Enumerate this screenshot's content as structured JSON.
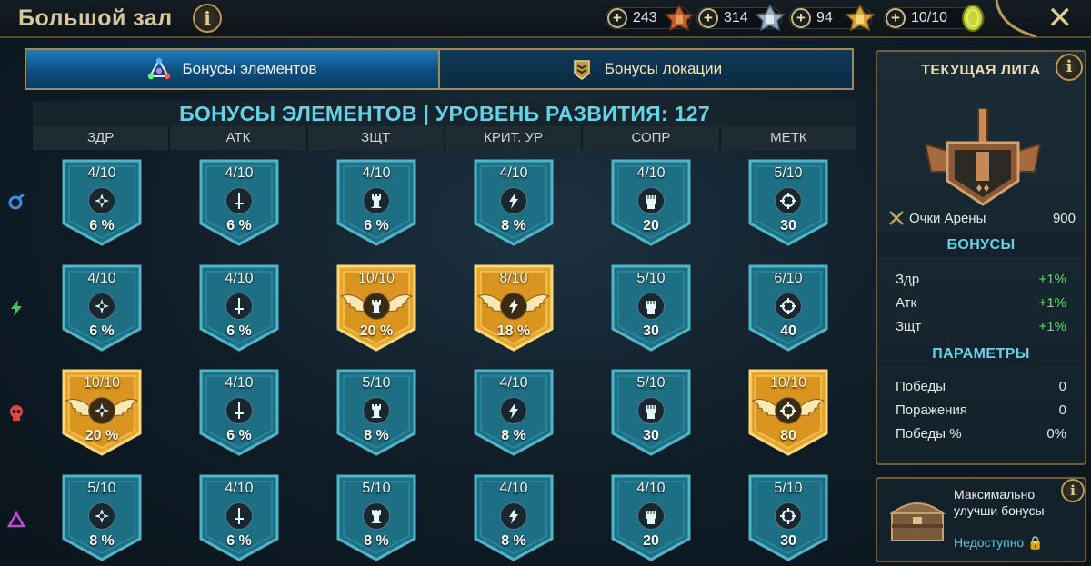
{
  "header": {
    "title": "Большой зал",
    "resources": [
      {
        "value": "243",
        "icon": "bronze-medal-icon",
        "color": "#c2622e"
      },
      {
        "value": "314",
        "icon": "silver-medal-icon",
        "color": "#9ab0c0"
      },
      {
        "value": "94",
        "icon": "gold-medal-icon",
        "color": "#d8a63a"
      },
      {
        "value": "10/10",
        "icon": "arena-token-icon",
        "color": "#c8d43a"
      }
    ]
  },
  "tabs": [
    {
      "label": "Бонусы элементов",
      "active": true,
      "icon": "elements-icon"
    },
    {
      "label": "Бонусы локации",
      "active": false,
      "icon": "location-rank-icon"
    }
  ],
  "grid": {
    "title": "БОНУСЫ ЭЛЕМЕНТОВ | УРОВЕНЬ РАЗВИТИЯ: 127",
    "columns": [
      "ЗДР",
      "АТК",
      "ЗЩТ",
      "КРИТ. УР",
      "СОПР",
      "МЕТК"
    ],
    "column_icons": [
      "health-icon",
      "sword-icon",
      "tower-icon",
      "lightning-icon",
      "fist-icon",
      "crosshair-icon"
    ],
    "rows": [
      {
        "affinity": "magic-affinity-icon",
        "color": "#3c8ce6",
        "cells": [
          {
            "level": "4/10",
            "value": "6 %",
            "max": false
          },
          {
            "level": "4/10",
            "value": "6 %",
            "max": false
          },
          {
            "level": "4/10",
            "value": "6 %",
            "max": false
          },
          {
            "level": "4/10",
            "value": "8 %",
            "max": false
          },
          {
            "level": "4/10",
            "value": "20",
            "max": false
          },
          {
            "level": "5/10",
            "value": "30",
            "max": false
          }
        ]
      },
      {
        "affinity": "spirit-affinity-icon",
        "color": "#3fcf4a",
        "cells": [
          {
            "level": "4/10",
            "value": "6 %",
            "max": false
          },
          {
            "level": "4/10",
            "value": "6 %",
            "max": false
          },
          {
            "level": "10/10",
            "value": "20 %",
            "max": true
          },
          {
            "level": "8/10",
            "value": "18 %",
            "max": true
          },
          {
            "level": "5/10",
            "value": "30",
            "max": false
          },
          {
            "level": "6/10",
            "value": "40",
            "max": false
          }
        ]
      },
      {
        "affinity": "force-affinity-icon",
        "color": "#e04444",
        "cells": [
          {
            "level": "10/10",
            "value": "20 %",
            "max": true
          },
          {
            "level": "4/10",
            "value": "6 %",
            "max": false
          },
          {
            "level": "5/10",
            "value": "8 %",
            "max": false
          },
          {
            "level": "4/10",
            "value": "8 %",
            "max": false
          },
          {
            "level": "5/10",
            "value": "30",
            "max": false
          },
          {
            "level": "10/10",
            "value": "80",
            "max": true
          }
        ]
      },
      {
        "affinity": "void-affinity-icon",
        "color": "#c84ad8",
        "cells": [
          {
            "level": "5/10",
            "value": "8 %",
            "max": false
          },
          {
            "level": "4/10",
            "value": "6 %",
            "max": false
          },
          {
            "level": "5/10",
            "value": "8 %",
            "max": false
          },
          {
            "level": "4/10",
            "value": "8 %",
            "max": false
          },
          {
            "level": "4/10",
            "value": "20",
            "max": false
          },
          {
            "level": "5/10",
            "value": "30",
            "max": false
          }
        ]
      }
    ]
  },
  "league": {
    "title": "ТЕКУЩАЯ ЛИГА",
    "arena_points_label": "Очки Арены",
    "arena_points": "900",
    "bonuses_title": "БОНУСЫ",
    "bonuses": [
      {
        "label": "Здр",
        "value": "+1%"
      },
      {
        "label": "Атк",
        "value": "+1%"
      },
      {
        "label": "Зщт",
        "value": "+1%"
      }
    ],
    "params_title": "ПАРАМЕТРЫ",
    "params": [
      {
        "label": "Победы",
        "value": "0"
      },
      {
        "label": "Поражения",
        "value": "0"
      },
      {
        "label": "Победы %",
        "value": "0%"
      }
    ]
  },
  "promo": {
    "text": "Максимально улучши бонусы",
    "status": "Недоступно"
  },
  "colors": {
    "teal_badge": "#1e6e82",
    "gold_badge": "#e0a830",
    "accent_cyan": "#62d4e8",
    "bonus_green": "#5fe35f"
  }
}
